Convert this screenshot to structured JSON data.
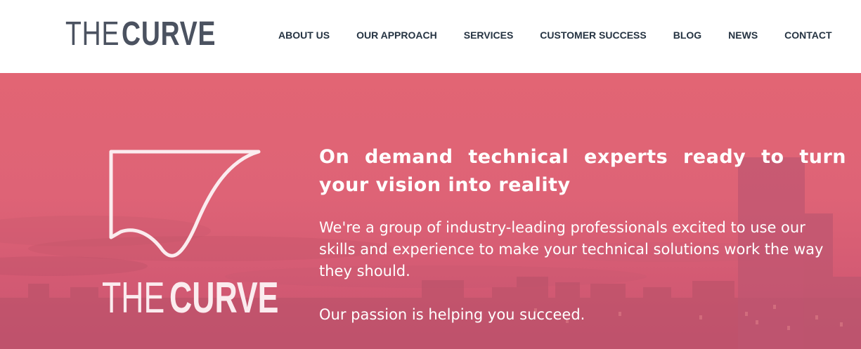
{
  "logo": {
    "word1": "THE",
    "word2": "CURVE"
  },
  "nav": [
    {
      "label": "ABOUT US"
    },
    {
      "label": "OUR APPROACH"
    },
    {
      "label": "SERVICES"
    },
    {
      "label": "CUSTOMER SUCCESS"
    },
    {
      "label": "BLOG"
    },
    {
      "label": "NEWS"
    },
    {
      "label": "CONTACT"
    }
  ],
  "hero": {
    "emblem_word1": "THE",
    "emblem_word2": "CURVE",
    "headline": "On demand technical experts ready to turn your vision into reality",
    "paragraph1": "We're a group of industry-leading professionals excited to use our skills and experience to make your technical solutions work the way they should.",
    "paragraph2": "Our passion is helping you succeed.",
    "overlay_color": "#e06374"
  },
  "colors": {
    "nav_text": "#253342",
    "logo_text": "#4b5260",
    "hero_text": "#ffffff"
  }
}
